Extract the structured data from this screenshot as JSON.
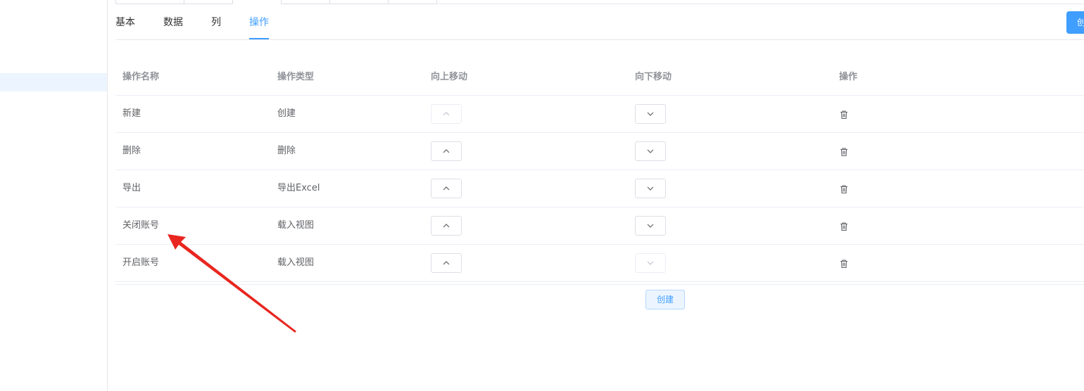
{
  "tabs": [
    {
      "label": "基本"
    },
    {
      "label": "数据"
    },
    {
      "label": "列"
    },
    {
      "label": "操作"
    }
  ],
  "active_tab": "操作",
  "top_create_label": "创",
  "table": {
    "headers": [
      "操作名称",
      "操作类型",
      "向上移动",
      "向下移动",
      "操作"
    ],
    "rows": [
      {
        "name": "新建",
        "type": "创建",
        "up_disabled": true,
        "down_disabled": false
      },
      {
        "name": "删除",
        "type": "删除",
        "up_disabled": false,
        "down_disabled": false
      },
      {
        "name": "导出",
        "type": "导出Excel",
        "up_disabled": false,
        "down_disabled": false
      },
      {
        "name": "关闭账号",
        "type": "载入视图",
        "up_disabled": false,
        "down_disabled": false
      },
      {
        "name": "开启账号",
        "type": "载入视图",
        "up_disabled": false,
        "down_disabled": true
      }
    ]
  },
  "create_button_label": "创建",
  "colors": {
    "accent": "#409eff",
    "annotation_arrow": "#e8261f"
  },
  "icons": {
    "move_up": "chevron-up-icon",
    "move_down": "chevron-down-icon",
    "delete": "trash-icon"
  }
}
